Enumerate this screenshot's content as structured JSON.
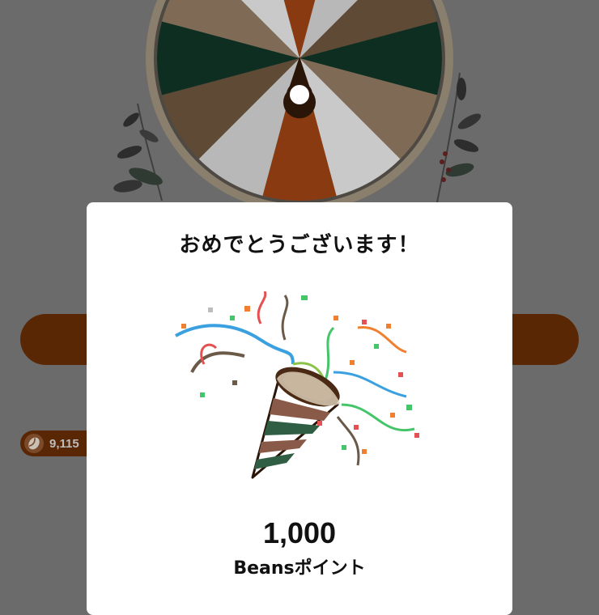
{
  "background": {
    "wheel": {
      "segment_colors": [
        "#8a3a10",
        "#b8b8b8",
        "#5f4a35",
        "#0f2e22",
        "#7f6b55",
        "#c9c9c9"
      ]
    },
    "leaves_icon": "coffee-branch-icon"
  },
  "points_pill": {
    "icon": "coffee-bean-icon",
    "value": "9,115"
  },
  "modal": {
    "title": "おめでとうございます！",
    "illustration": "party-popper-icon",
    "amount": "1,000",
    "unit": "Beansポイント"
  },
  "colors": {
    "overlay": "#6b6b6b",
    "brown": "#5a2705",
    "modal_bg": "#ffffff"
  }
}
